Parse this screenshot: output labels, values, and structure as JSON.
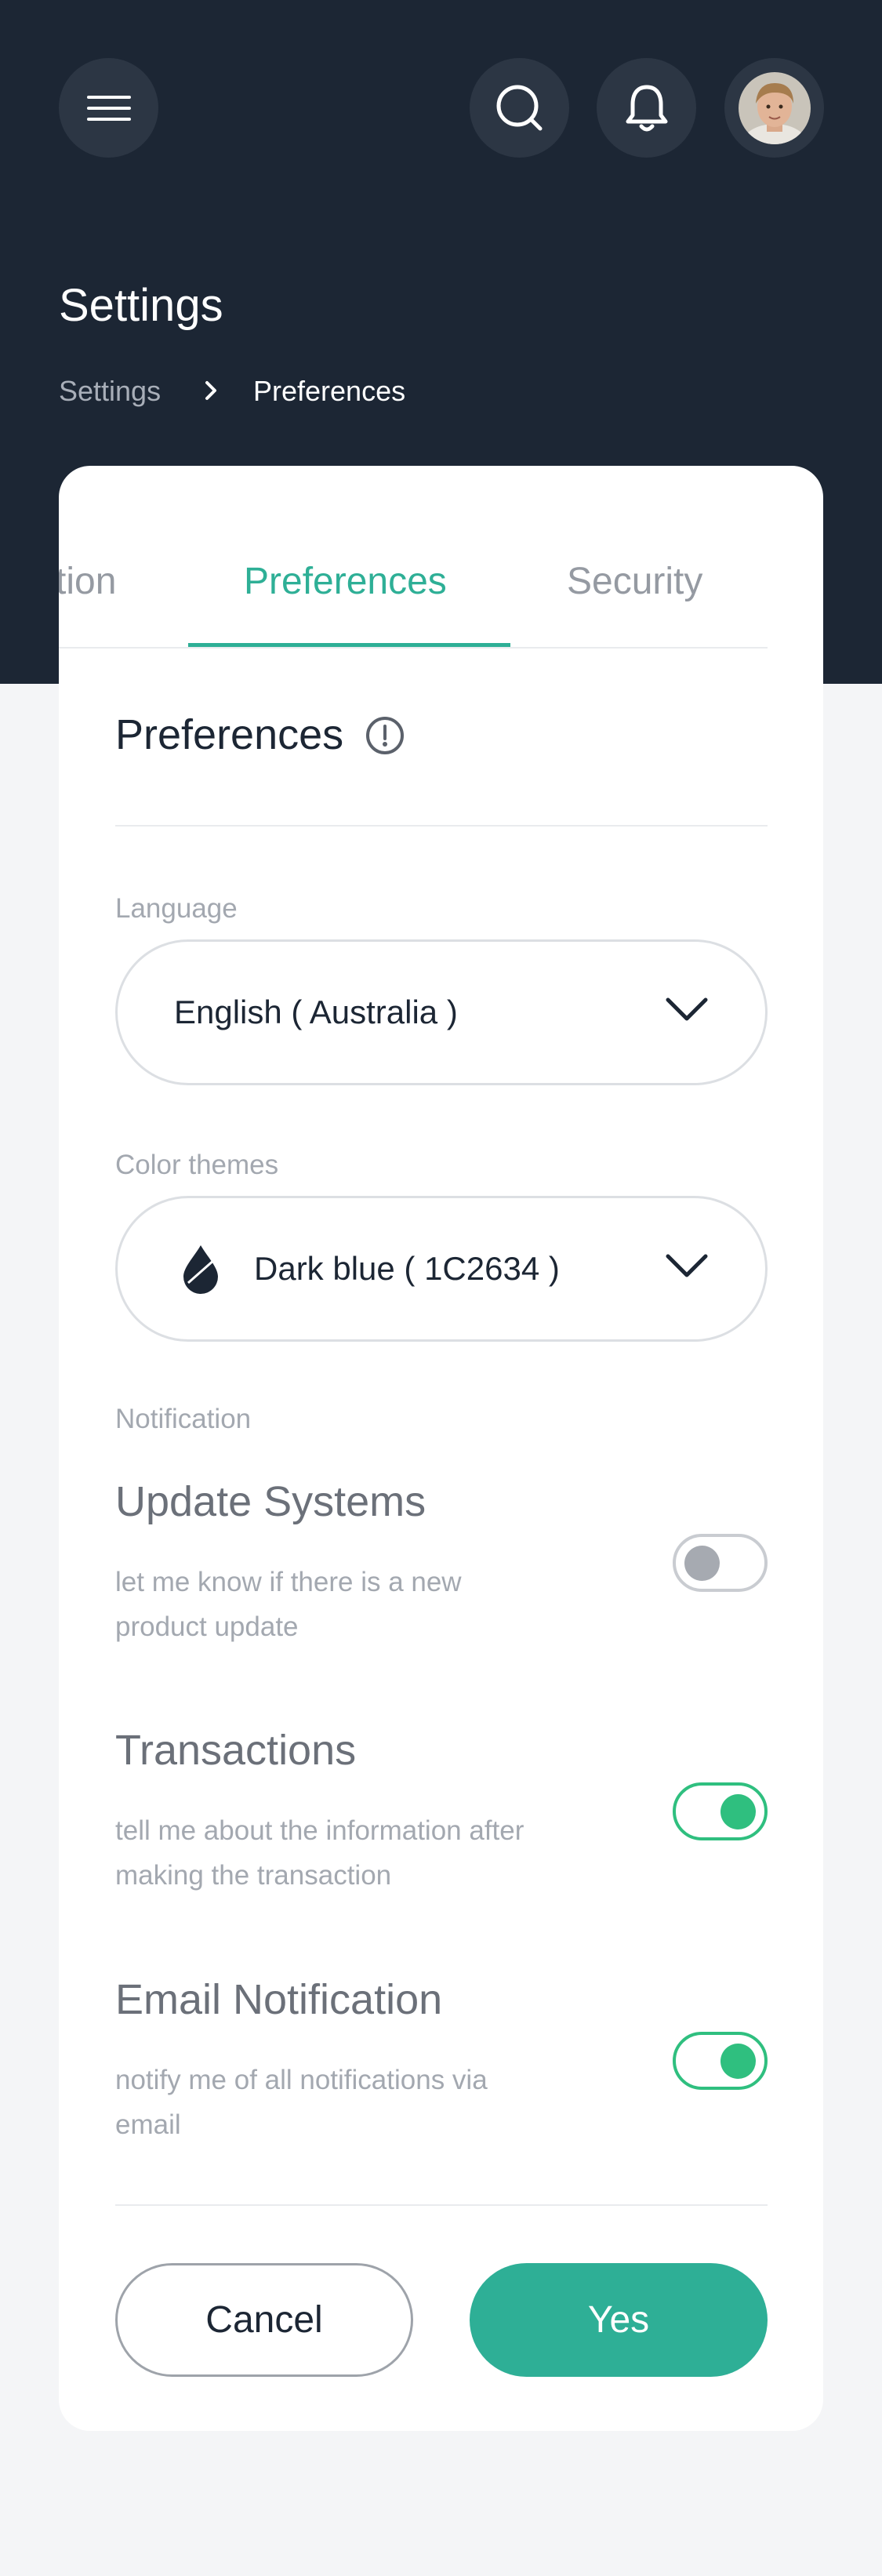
{
  "header": {
    "menu_icon": "hamburger-menu-icon",
    "search_icon": "search-icon",
    "bell_icon": "bell-icon",
    "avatar": "user-avatar"
  },
  "page": {
    "title": "Settings",
    "breadcrumb": {
      "root": "Settings",
      "separator_icon": "chevron-right-icon",
      "current": "Preferences"
    }
  },
  "tabs": [
    {
      "label": "tion",
      "active": false
    },
    {
      "label": "Preferences",
      "active": true
    },
    {
      "label": "Security",
      "active": false
    }
  ],
  "preferences": {
    "title": "Preferences",
    "info_icon": "info-icon",
    "language": {
      "label": "Language",
      "value": "English ( Australia )"
    },
    "color_theme": {
      "label": "Color themes",
      "value": "Dark blue ( 1C2634 )",
      "swatch_color": "#1C2634"
    },
    "notification": {
      "label": "Notification",
      "items": [
        {
          "title": "Update Systems",
          "desc": "let me know if there is a new product update",
          "enabled": false
        },
        {
          "title": "Transactions",
          "desc": "tell me about the information after making the transaction",
          "enabled": true
        },
        {
          "title": "Email Notification",
          "desc": "notify me of all notifications via email",
          "enabled": true
        }
      ]
    }
  },
  "actions": {
    "cancel_label": "Cancel",
    "confirm_label": "Yes"
  },
  "colors": {
    "header_bg": "#1C2634",
    "accent": "#2EAF96",
    "toggle_on": "#2FBF7F"
  }
}
